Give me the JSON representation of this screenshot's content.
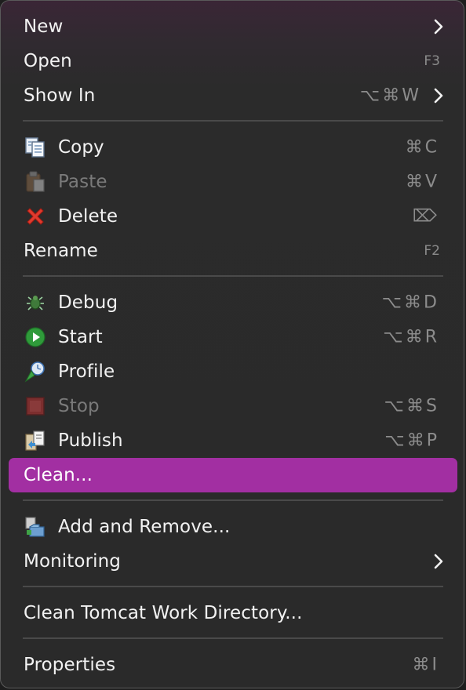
{
  "menu": {
    "highlight_color": "#a22fa2",
    "items": {
      "new": {
        "label": "New",
        "icon": null,
        "submenu": true
      },
      "open": {
        "label": "Open",
        "shortcut": "F3"
      },
      "show_in": {
        "label": "Show In",
        "shortcut": "⌥⌘W",
        "submenu": true
      },
      "copy": {
        "label": "Copy",
        "icon": "copy-icon",
        "shortcut": "⌘C"
      },
      "paste": {
        "label": "Paste",
        "icon": "paste-icon",
        "shortcut": "⌘V",
        "disabled": true
      },
      "delete": {
        "label": "Delete",
        "icon": "delete-x-icon",
        "shortcut": "⌦"
      },
      "rename": {
        "label": "Rename",
        "shortcut": "F2"
      },
      "debug": {
        "label": "Debug",
        "icon": "bug-icon",
        "shortcut": "⌥⌘D"
      },
      "start": {
        "label": "Start",
        "icon": "play-icon",
        "shortcut": "⌥⌘R"
      },
      "profile": {
        "label": "Profile",
        "icon": "profile-icon"
      },
      "stop": {
        "label": "Stop",
        "icon": "stop-icon",
        "shortcut": "⌥⌘S",
        "disabled": true
      },
      "publish": {
        "label": "Publish",
        "icon": "publish-icon",
        "shortcut": "⌥⌘P"
      },
      "clean": {
        "label": "Clean...",
        "highlighted": true
      },
      "add_remove": {
        "label": "Add and Remove...",
        "icon": "add-remove-icon"
      },
      "monitoring": {
        "label": "Monitoring",
        "submenu": true
      },
      "clean_tomcat": {
        "label": "Clean Tomcat Work Directory..."
      },
      "properties": {
        "label": "Properties",
        "shortcut": "⌘I"
      }
    }
  }
}
